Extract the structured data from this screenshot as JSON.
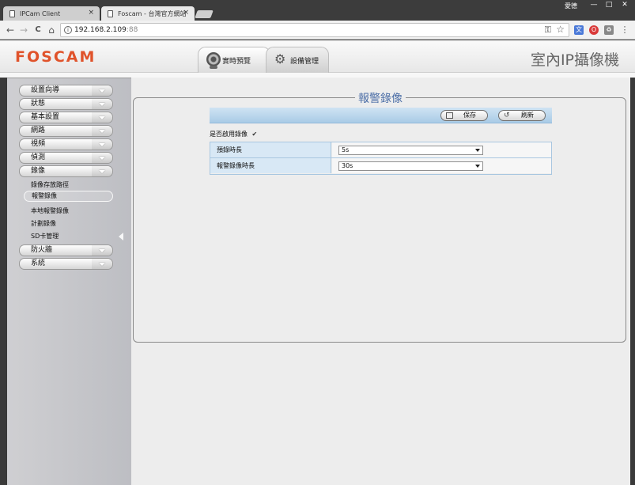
{
  "browser": {
    "tabs": [
      {
        "title": "IPCam Client",
        "close": "×"
      },
      {
        "title": "Foscam - 台灣官方網站",
        "close": "×"
      }
    ],
    "user_label": "愛德",
    "window_controls": {
      "minimize": "—",
      "maximize": "□",
      "close": "✕"
    },
    "nav": {
      "back": "←",
      "forward": "→",
      "reload": "C",
      "home": "⌂"
    },
    "address": {
      "host": "192.168.2.109",
      "port": ":88"
    },
    "icons": {
      "info": "i",
      "key": "⚿",
      "star": "☆",
      "menu": "⋮"
    },
    "extensions": [
      {
        "name": "translate-extension-icon",
        "glyph": "文",
        "color": "#4a79d8"
      },
      {
        "name": "opera-extension-icon",
        "glyph": "O",
        "color": "#d93a3a"
      },
      {
        "name": "settings-extension-icon",
        "glyph": "♻",
        "color": "#888888"
      }
    ]
  },
  "header": {
    "logo": "FOSCAM",
    "nav": [
      {
        "label": "實時預覽",
        "icon": "camera-icon"
      },
      {
        "label": "設備管理",
        "icon": "gear-icon"
      }
    ],
    "product_title": "室內IP攝像機"
  },
  "sidebar": {
    "menu_before": [
      {
        "label": "設置向導"
      },
      {
        "label": "狀態"
      },
      {
        "label": "基本設置"
      },
      {
        "label": "網路"
      },
      {
        "label": "視頻"
      },
      {
        "label": "偵測"
      },
      {
        "label": "錄像"
      }
    ],
    "sub_items": [
      {
        "label": "錄像存放路徑",
        "active": false
      },
      {
        "label": "報警錄像",
        "active": true
      },
      {
        "label": "本地報警錄像",
        "active": false
      },
      {
        "label": "計劃錄像",
        "active": false
      },
      {
        "label": "SD卡管理",
        "active": false
      }
    ],
    "menu_after": [
      {
        "label": "防火牆"
      },
      {
        "label": "系統"
      }
    ]
  },
  "main": {
    "section_title": "報警錄像",
    "actions": {
      "save": "保存",
      "refresh": "刷新"
    },
    "enable_label": "是否啟用錄像",
    "enable_checked": true,
    "check_glyph": "✔",
    "rows": [
      {
        "label": "預錄時長",
        "value": "5s"
      },
      {
        "label": "報警錄像時長",
        "value": "30s"
      }
    ]
  },
  "colors": {
    "logo": "#e0532b",
    "legend": "#4d6fa7",
    "action_bar": "#a9cbe6"
  }
}
